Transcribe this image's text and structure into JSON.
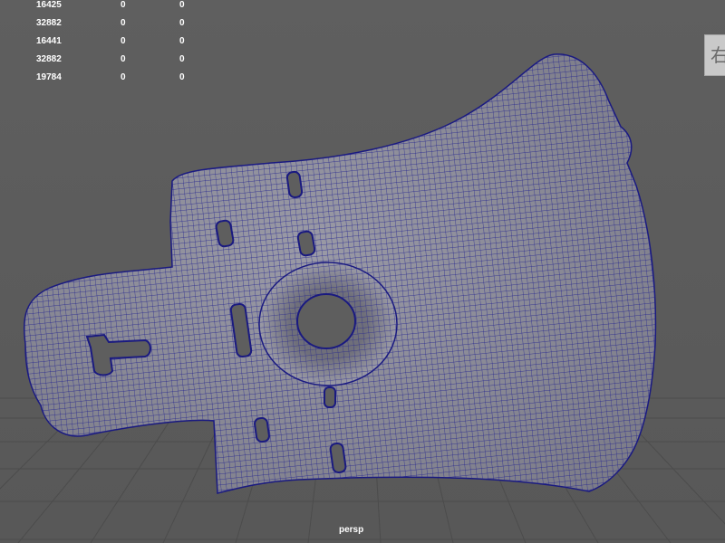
{
  "hud": {
    "rows": [
      {
        "a": "16425",
        "b": "0",
        "c": "0"
      },
      {
        "a": "32882",
        "b": "0",
        "c": "0"
      },
      {
        "a": "16441",
        "b": "0",
        "c": "0"
      },
      {
        "a": "32882",
        "b": "0",
        "c": "0"
      },
      {
        "a": "19784",
        "b": "0",
        "c": "0"
      }
    ]
  },
  "viewport": {
    "camera": "persp",
    "side_tab_glyph": "右"
  },
  "colors": {
    "background": "#5d5d5d",
    "grid": "#4a4a4a",
    "mesh_surface": "#8a8a96",
    "wireframe": "#1a1a8c",
    "hud_text": "#ffffff"
  },
  "icons": {
    "side_tab": "panel-tab-icon"
  }
}
